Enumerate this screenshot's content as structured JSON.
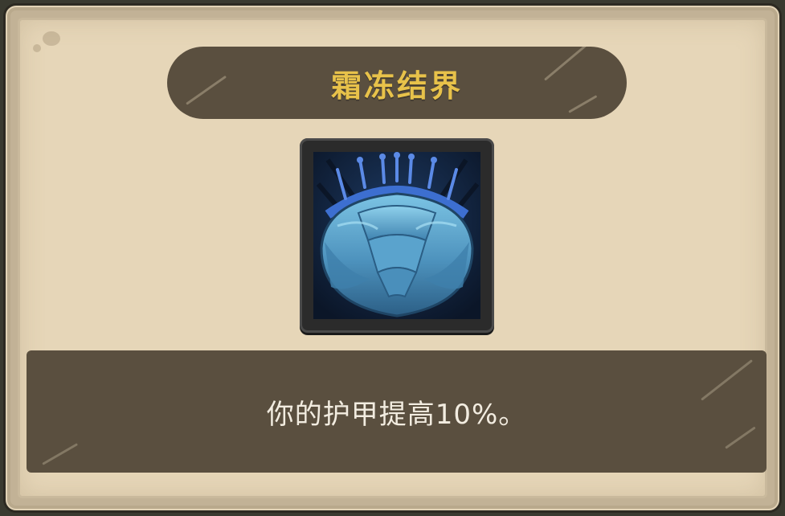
{
  "skill": {
    "title": "霜冻结界",
    "description": "你的护甲提高10%。",
    "icon": "frost-armor-shield-icon"
  },
  "colors": {
    "title_text": "#e8c24a",
    "banner_bg": "#5a4f3f",
    "parchment": "#e6d6b8",
    "description_text": "#f2ece0"
  }
}
